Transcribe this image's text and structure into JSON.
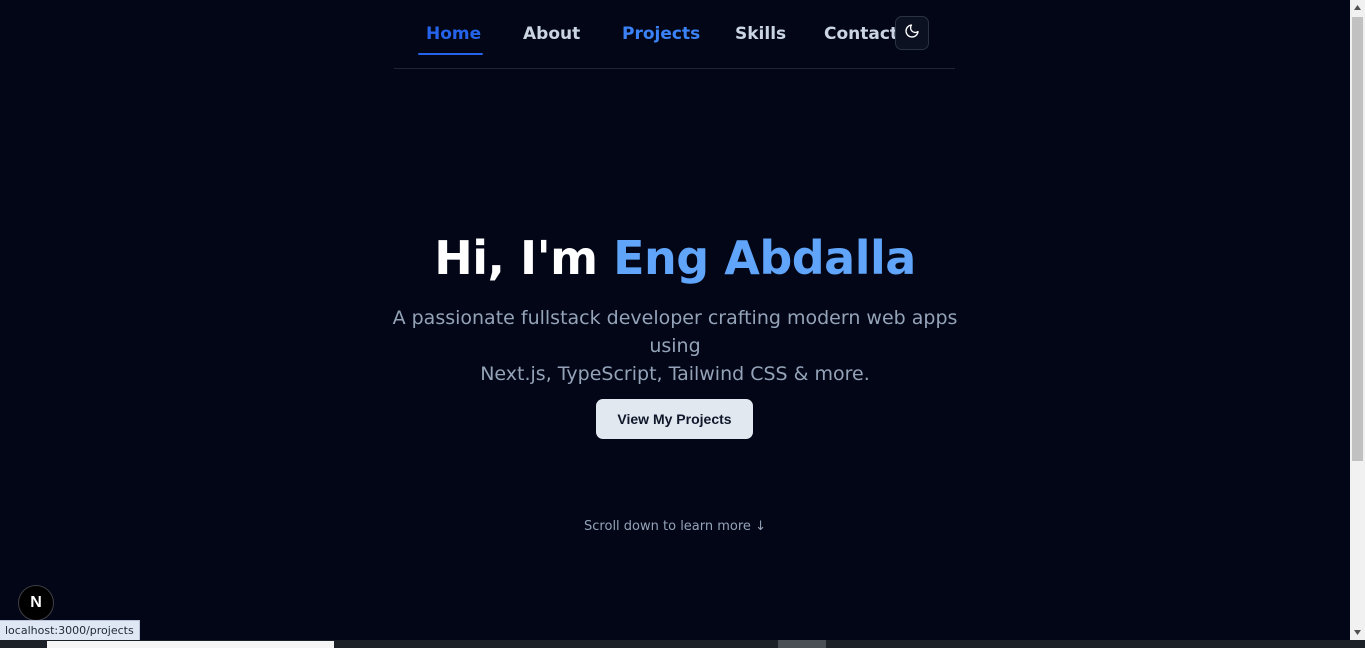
{
  "nav": {
    "items": [
      {
        "label": "Home",
        "active": true
      },
      {
        "label": "About"
      },
      {
        "label": "Projects",
        "hovered": true
      },
      {
        "label": "Skills"
      },
      {
        "label": "Contact"
      }
    ],
    "theme_toggle_icon": "moon-icon"
  },
  "hero": {
    "greeting": "Hi, I'm",
    "name": "Eng Abdalla",
    "subtitle_line1": "A passionate fullstack developer crafting modern web apps using",
    "subtitle_line2": "Next.js, TypeScript, Tailwind CSS & more.",
    "cta_label": "View My Projects",
    "scroll_hint": "Scroll down to learn more ↓"
  },
  "status_bar": {
    "url": "localhost:3000/projects"
  },
  "next_badge": {
    "letter": "N"
  },
  "colors": {
    "background": "#020617",
    "accent": "#60a5fa",
    "nav_active": "#2563eb",
    "text_muted": "#94a3b8"
  }
}
